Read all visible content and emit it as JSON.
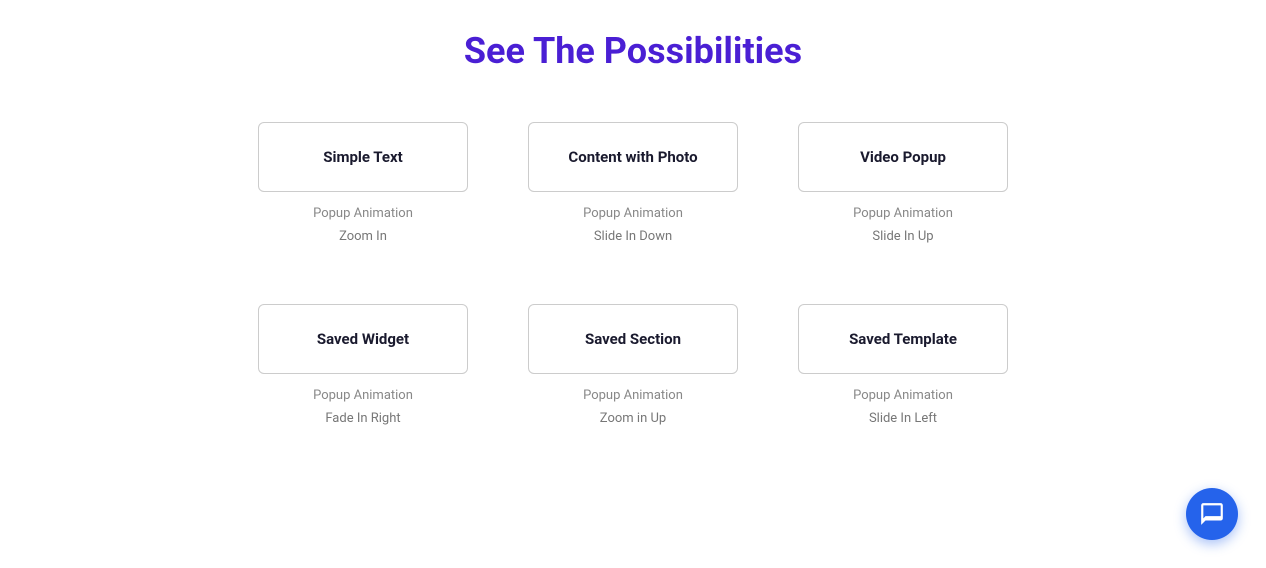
{
  "header": {
    "title": "See The Possibilities",
    "color": "#4a1fd4"
  },
  "rows": [
    {
      "id": "row1",
      "cards": [
        {
          "id": "simple-text",
          "title": "Simple Text",
          "popup_label": "Popup Animation",
          "animation": "Zoom In"
        },
        {
          "id": "content-with-photo",
          "title": "Content with Photo",
          "popup_label": "Popup Animation",
          "animation": "Slide In Down"
        },
        {
          "id": "video-popup",
          "title": "Video Popup",
          "popup_label": "Popup Animation",
          "animation": "Slide In Up"
        }
      ]
    },
    {
      "id": "row2",
      "cards": [
        {
          "id": "saved-widget",
          "title": "Saved Widget",
          "popup_label": "Popup Animation",
          "animation": "Fade In Right"
        },
        {
          "id": "saved-section",
          "title": "Saved Section",
          "popup_label": "Popup Animation",
          "animation": "Zoom in Up"
        },
        {
          "id": "saved-template",
          "title": "Saved Template",
          "popup_label": "Popup Animation",
          "animation": "Slide In Left"
        }
      ]
    }
  ],
  "chat": {
    "label": "Chat"
  }
}
